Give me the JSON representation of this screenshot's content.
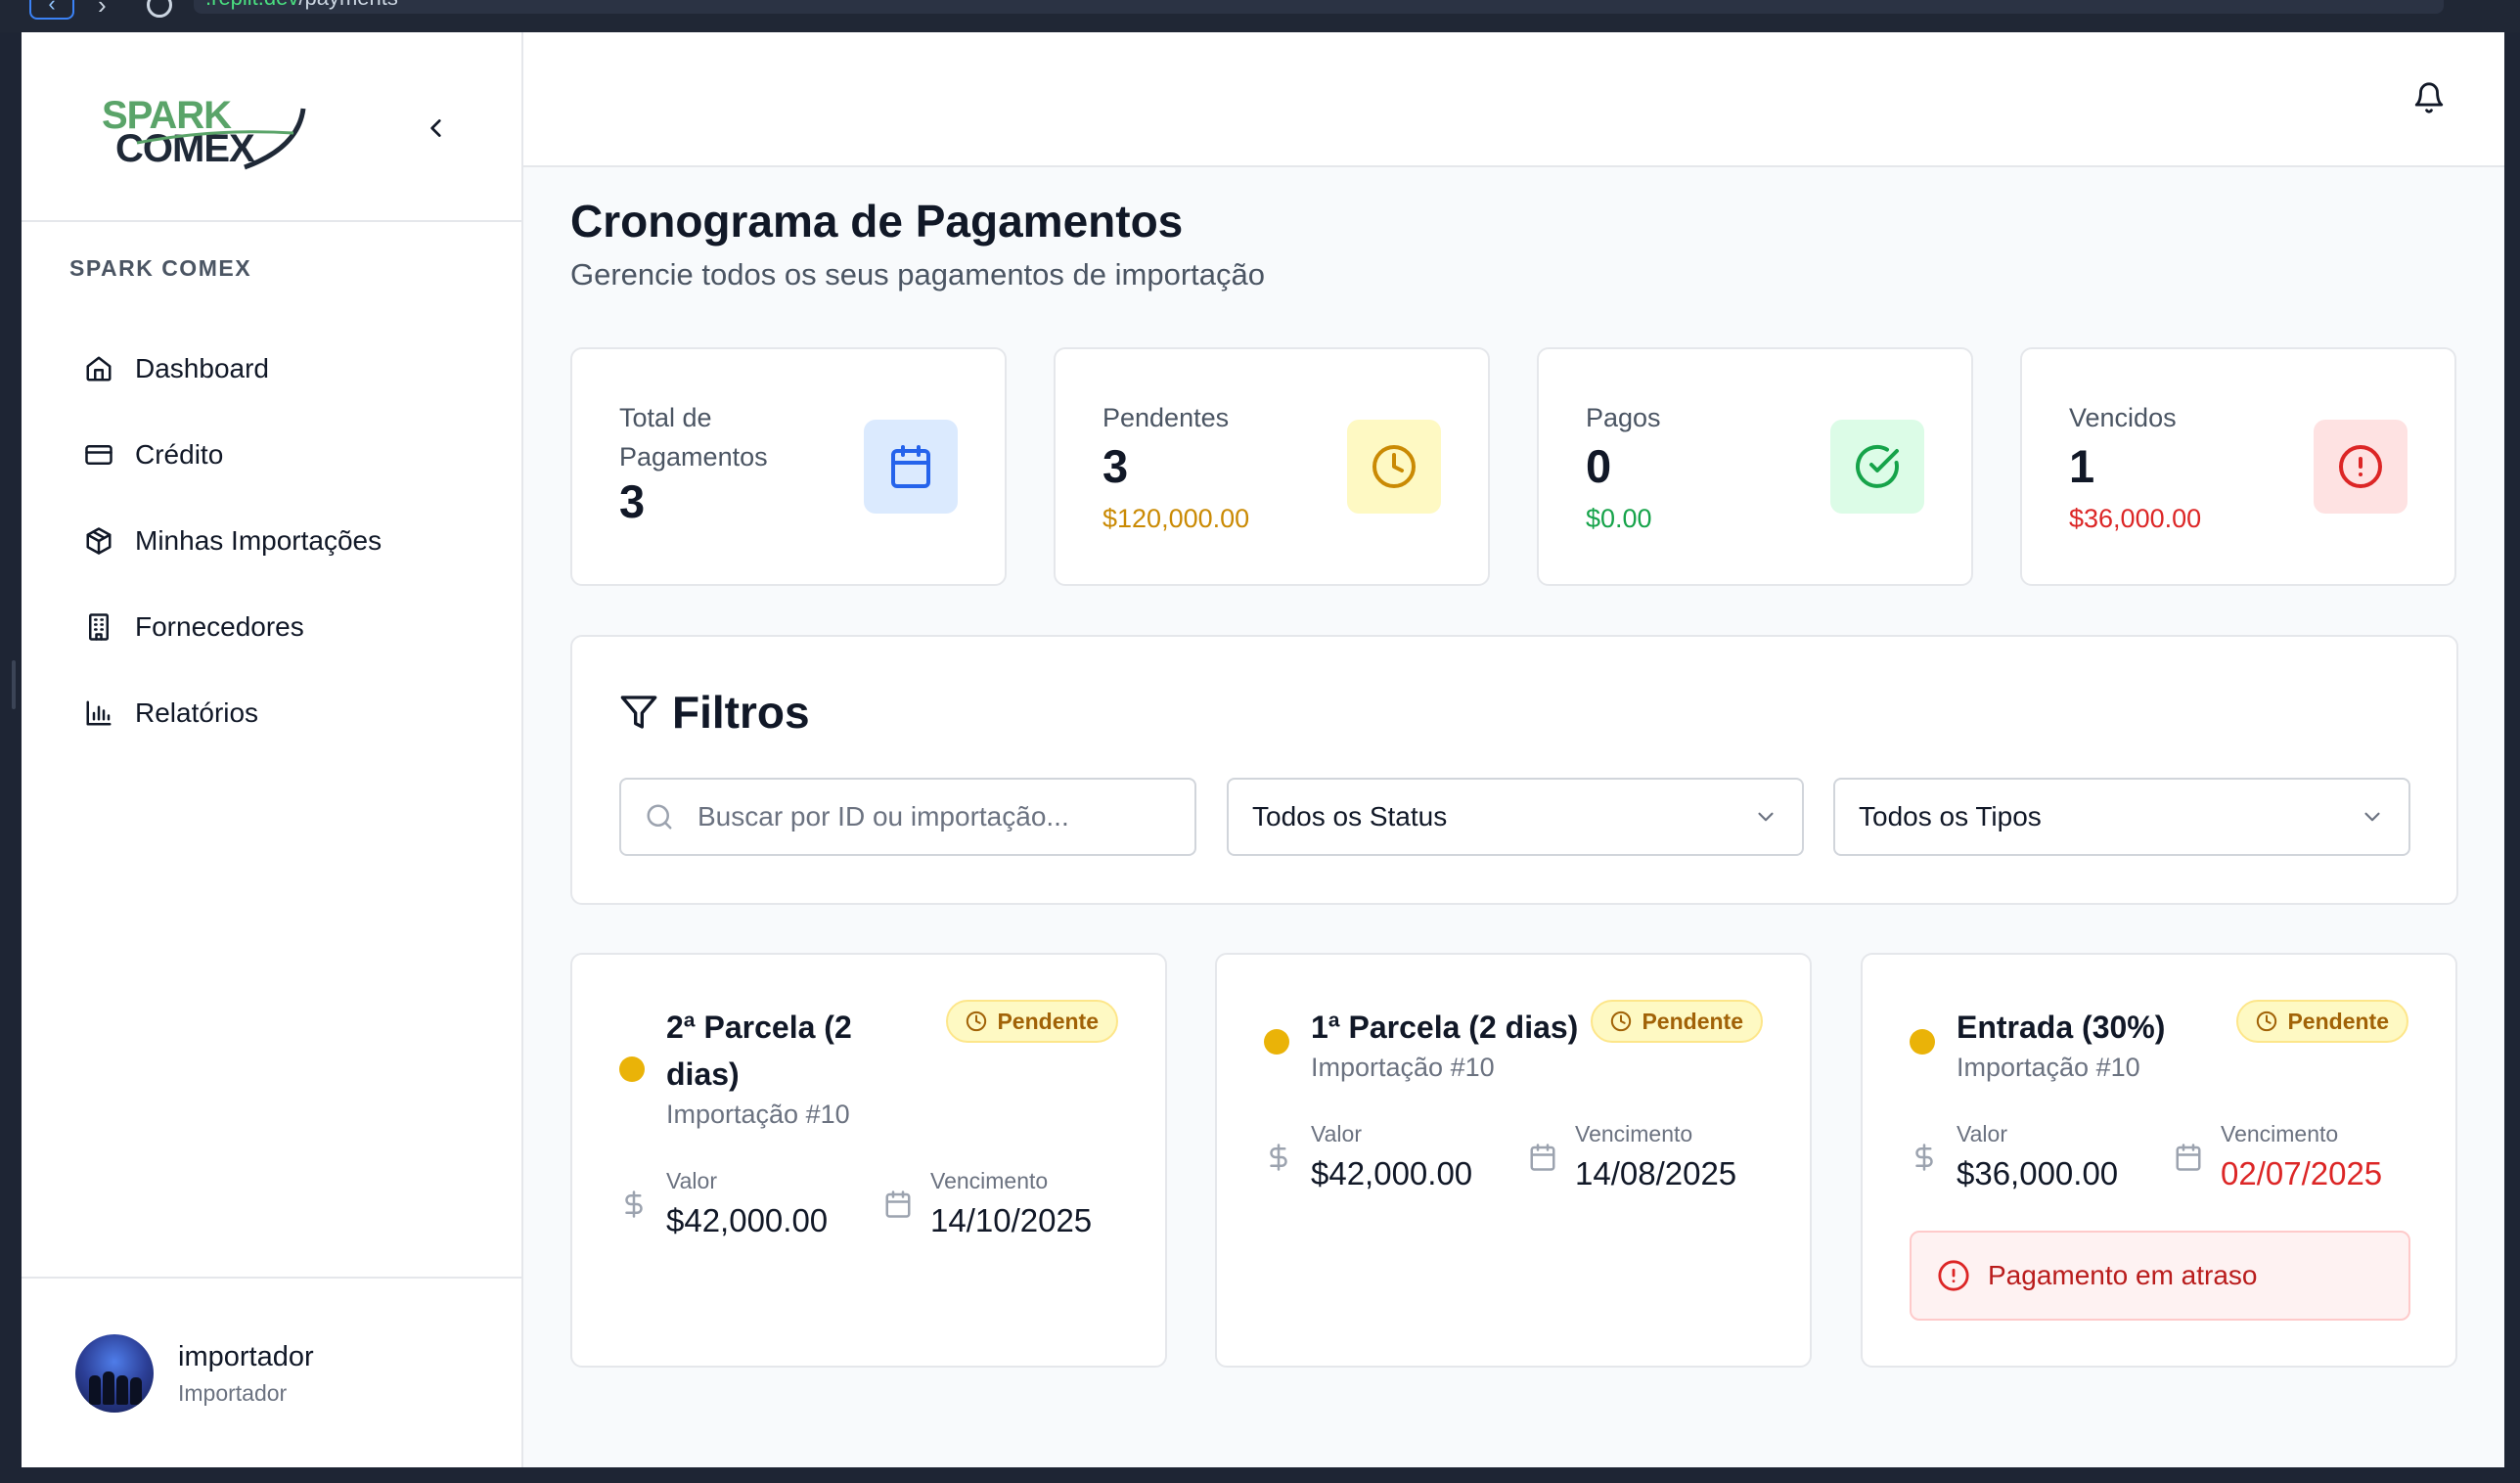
{
  "browser": {
    "url_host": ".replit.dev",
    "url_path": "/payments"
  },
  "sidebar": {
    "logo_line1": "SPARK",
    "logo_line2": "COMEX",
    "section_label": "SPARK COMEX",
    "items": [
      {
        "label": "Dashboard",
        "icon": "home-icon"
      },
      {
        "label": "Crédito",
        "icon": "credit-card-icon"
      },
      {
        "label": "Minhas Importações",
        "icon": "package-icon"
      },
      {
        "label": "Fornecedores",
        "icon": "building-icon"
      },
      {
        "label": "Relatórios",
        "icon": "bar-chart-icon"
      }
    ],
    "user": {
      "name": "importador",
      "role": "Importador"
    }
  },
  "header": {
    "title": "Cronograma de Pagamentos",
    "subtitle": "Gerencie todos os seus pagamentos de importação"
  },
  "stats": [
    {
      "label": "Total de Pagamentos",
      "value": "3",
      "amount": "",
      "icon": "calendar-icon",
      "color": "#2563eb",
      "bg": "#dbeafe"
    },
    {
      "label": "Pendentes",
      "value": "3",
      "amount": "$120,000.00",
      "icon": "clock-icon",
      "color": "#ca8a04",
      "bg": "#fef9c3"
    },
    {
      "label": "Pagos",
      "value": "0",
      "amount": "$0.00",
      "icon": "check-circle-icon",
      "color": "#16a34a",
      "bg": "#dcfce7"
    },
    {
      "label": "Vencidos",
      "value": "1",
      "amount": "$36,000.00",
      "icon": "alert-circle-icon",
      "color": "#dc2626",
      "bg": "#fee2e2"
    }
  ],
  "filters": {
    "title": "Filtros",
    "search_placeholder": "Buscar por ID ou importação...",
    "status_select": "Todos os Status",
    "type_select": "Todos os Tipos"
  },
  "payments": [
    {
      "title_line1": "2ª Parcela (2",
      "title_line2": "dias)",
      "import": "Importação #10",
      "status": "Pendente",
      "value_label": "Valor",
      "value": "$42,000.00",
      "due_label": "Vencimento",
      "due": "14/10/2025",
      "overdue": false
    },
    {
      "title_line1": "1ª Parcela (2 dias)",
      "title_line2": "",
      "import": "Importação #10",
      "status": "Pendente",
      "value_label": "Valor",
      "value": "$42,000.00",
      "due_label": "Vencimento",
      "due": "14/08/2025",
      "overdue": false
    },
    {
      "title_line1": "Entrada (30%)",
      "title_line2": "",
      "import": "Importação #10",
      "status": "Pendente",
      "value_label": "Valor",
      "value": "$36,000.00",
      "due_label": "Vencimento",
      "due": "02/07/2025",
      "overdue": true,
      "overdue_text": "Pagamento em atraso"
    }
  ],
  "colors": {
    "pending_dot": "#eab308",
    "overdue_red": "#dc2626",
    "logo_green": "#5aa469",
    "logo_dark": "#1f2937"
  }
}
